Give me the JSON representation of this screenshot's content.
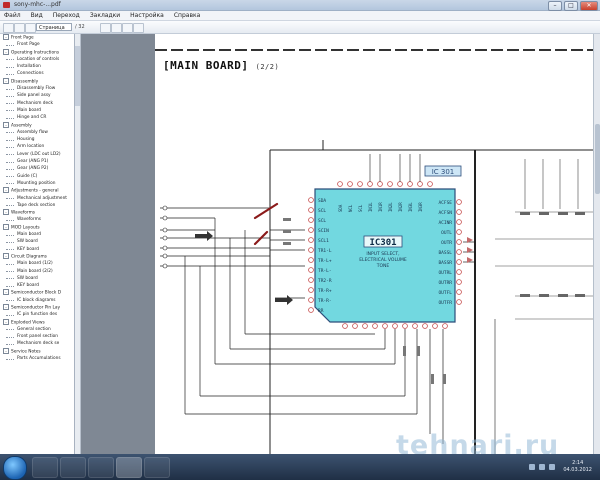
{
  "window": {
    "title": "sony-mhc-...pdf",
    "buttons": {
      "minimize": "–",
      "maximize": "□",
      "close": "✕"
    }
  },
  "menubar": {
    "items": [
      "Файл",
      "Вид",
      "Переход",
      "Закладки",
      "Настройка",
      "Справка"
    ]
  },
  "toolbar": {
    "page_value": "Страница",
    "page_count": "/ 32"
  },
  "sidebar": {
    "items": [
      {
        "label": "Front Page",
        "level": 0,
        "toggle": "–"
      },
      {
        "label": "Front Page",
        "level": 1
      },
      {
        "label": "Operating Instructions",
        "level": 0,
        "toggle": "–"
      },
      {
        "label": "Location of controls",
        "level": 1
      },
      {
        "label": "Installation",
        "level": 1
      },
      {
        "label": "Connections",
        "level": 1
      },
      {
        "label": "Disassembly",
        "level": 0,
        "toggle": "–"
      },
      {
        "label": "Disassembly Flow",
        "level": 1
      },
      {
        "label": "Side panel assy",
        "level": 1
      },
      {
        "label": "Mechanism deck",
        "level": 1
      },
      {
        "label": "Main board",
        "level": 1
      },
      {
        "label": "Hinge and CR",
        "level": 1
      },
      {
        "label": "Assembly",
        "level": 0,
        "toggle": "–"
      },
      {
        "label": "Assembly flow",
        "level": 1
      },
      {
        "label": "Housing",
        "level": 1
      },
      {
        "label": "Arm location",
        "level": 1
      },
      {
        "label": "Lever (LDC out LD2)",
        "level": 1
      },
      {
        "label": "Gear (ANG P1)",
        "level": 1
      },
      {
        "label": "Gear (ANG P2)",
        "level": 1
      },
      {
        "label": "Guide (C)",
        "level": 1
      },
      {
        "label": "Mounting position",
        "level": 1
      },
      {
        "label": "Adjustments - general",
        "level": 0,
        "toggle": "–"
      },
      {
        "label": "Mechanical adjustment",
        "level": 1
      },
      {
        "label": "Tape deck section",
        "level": 1
      },
      {
        "label": "Waveforms",
        "level": 0,
        "toggle": "–"
      },
      {
        "label": "Waveforms",
        "level": 1
      },
      {
        "label": "MOD Layouts",
        "level": 0,
        "toggle": "–"
      },
      {
        "label": "Main board",
        "level": 1
      },
      {
        "label": "SW board",
        "level": 1
      },
      {
        "label": "KEY board",
        "level": 1
      },
      {
        "label": "Circuit Diagrams",
        "level": 0,
        "toggle": "–"
      },
      {
        "label": "Main board (1/2)",
        "level": 1
      },
      {
        "label": "Main board (2/2)",
        "level": 1
      },
      {
        "label": "SW board",
        "level": 1
      },
      {
        "label": "KEY board",
        "level": 1
      },
      {
        "label": "Semiconductor Block D",
        "level": 0,
        "toggle": "–"
      },
      {
        "label": "IC block diagrams",
        "level": 1
      },
      {
        "label": "Semiconductor Pin Lay",
        "level": 0,
        "toggle": "–"
      },
      {
        "label": "IC pin function des",
        "level": 1
      },
      {
        "label": "Exploded Views",
        "level": 0,
        "toggle": "–"
      },
      {
        "label": "General section",
        "level": 1
      },
      {
        "label": "Front panel section",
        "level": 1
      },
      {
        "label": "Mechanism deck se",
        "level": 1
      },
      {
        "label": "Service Notes",
        "level": 0,
        "toggle": "–"
      },
      {
        "label": "Parts Accumulations",
        "level": 1
      }
    ]
  },
  "document": {
    "heading": "[MAIN BOARD]",
    "heading_sub": "(2/2)",
    "ic_ref": "IC301",
    "ic_ref_tag": "IC 301",
    "ic_desc_1": "INPUT SELECT,",
    "ic_desc_2": "ELECTRICAL VOLUME",
    "ic_desc_3": "TONE",
    "left_pins": [
      "SDA",
      "SCL",
      "SCL",
      "SCIN",
      "SCL1",
      "TR1-L",
      "TR-L+",
      "TR-L-",
      "TR2-R",
      "TR-R+",
      "TR-R-",
      "RR"
    ],
    "right_pins": [
      "ACFSE",
      "ACFSN",
      "ACINR",
      "OUTL",
      "OUTR",
      "BASSL",
      "BASSR",
      "OUTRL",
      "OUTRR",
      "OUTFL",
      "OUTFR"
    ],
    "top_pins": [
      "SDA",
      "NCL",
      "SCL",
      "IN1L",
      "IN1R",
      "IN2L",
      "IN2R",
      "IN3L",
      "IN3R"
    ]
  },
  "taskbar": {
    "clock_time": "2:14",
    "clock_date": "04.03.2012"
  },
  "watermark": "tehnari.ru",
  "colors": {
    "ic_fill": "#72d8e0",
    "ic_stroke": "#2d4d7a",
    "wire": "#222222",
    "accent_pin": "#c54a4a",
    "arrow_mark": "#8b1a1a"
  }
}
